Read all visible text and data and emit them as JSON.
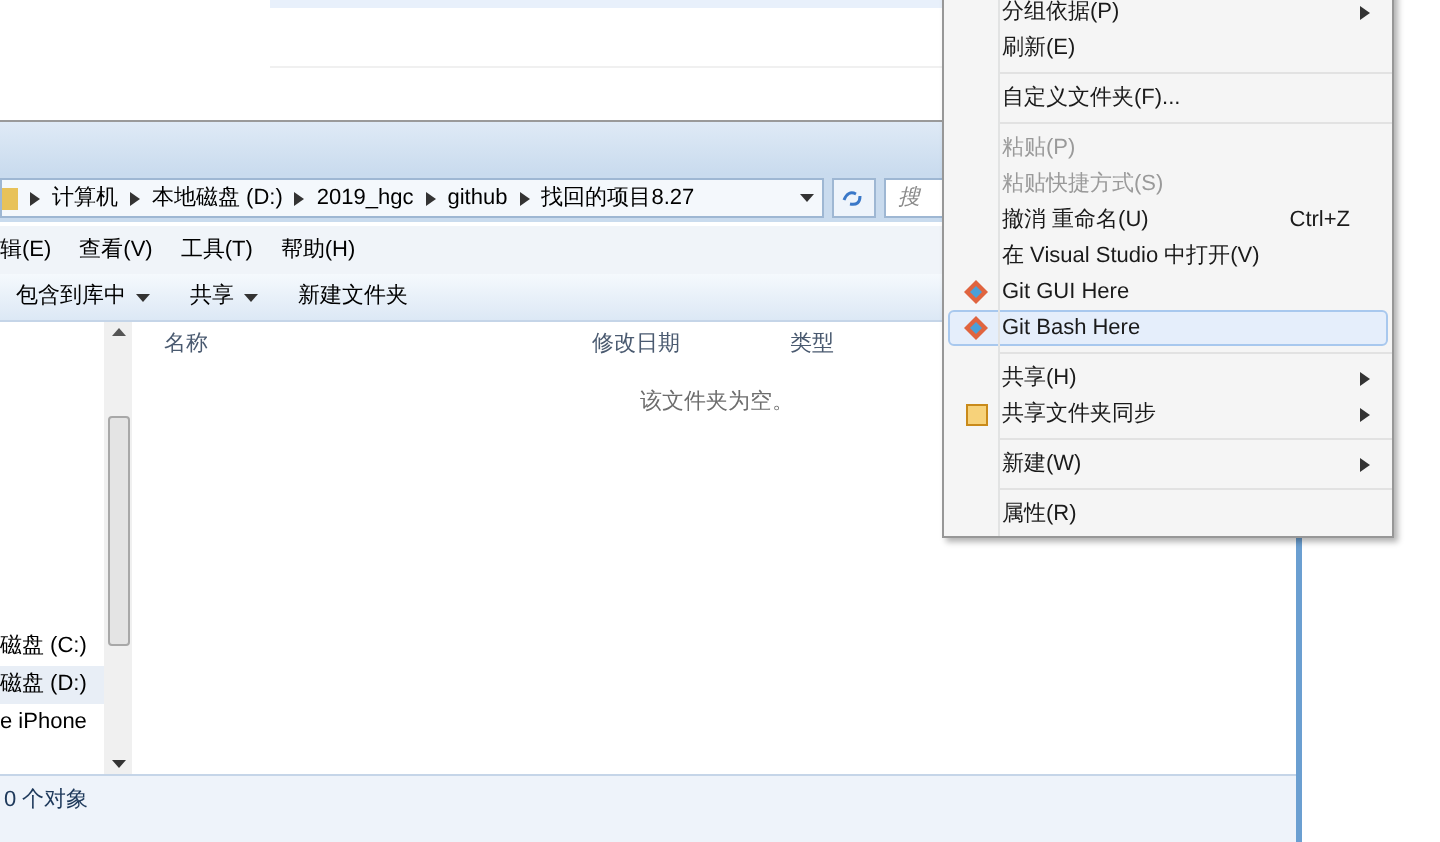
{
  "explorer": {
    "breadcrumb": [
      "计算机",
      "本地磁盘 (D:)",
      "2019_hgc",
      "github",
      "找回的项目8.27"
    ],
    "search": {
      "placeholder": "搜"
    },
    "menu_bar": [
      "辑(E)",
      "查看(V)",
      "工具(T)",
      "帮助(H)"
    ],
    "toolbar": [
      {
        "label": "包含到库中",
        "dropdown": true
      },
      {
        "label": "共享",
        "dropdown": true
      },
      {
        "label": "新建文件夹",
        "dropdown": false
      }
    ],
    "columns": [
      "名称",
      "修改日期",
      "类型"
    ],
    "empty_message": "该文件夹为空。",
    "sidebar": [
      {
        "label": "磁盘 (C:)",
        "selected": false
      },
      {
        "label": "磁盘 (D:)",
        "selected": true
      },
      {
        "label": "e iPhone",
        "selected": false
      }
    ],
    "status": "0 个对象"
  },
  "context_menu": [
    {
      "kind": "item",
      "label": "分组依据(P)",
      "submenu": true,
      "disabled": false,
      "selected": false
    },
    {
      "kind": "item",
      "label": "刷新(E)",
      "submenu": false,
      "disabled": false,
      "selected": false
    },
    {
      "kind": "separator"
    },
    {
      "kind": "item",
      "label": "自定义文件夹(F)...",
      "submenu": false,
      "disabled": false,
      "selected": false
    },
    {
      "kind": "separator"
    },
    {
      "kind": "item",
      "label": "粘贴(P)",
      "submenu": false,
      "disabled": true,
      "selected": false
    },
    {
      "kind": "item",
      "label": "粘贴快捷方式(S)",
      "submenu": false,
      "disabled": true,
      "selected": false
    },
    {
      "kind": "item",
      "label": "撤消 重命名(U)",
      "shortcut": "Ctrl+Z",
      "submenu": false,
      "disabled": false,
      "selected": false
    },
    {
      "kind": "item",
      "label": "在 Visual Studio 中打开(V)",
      "submenu": false,
      "disabled": false,
      "selected": false
    },
    {
      "kind": "git",
      "label": "Git GUI Here",
      "submenu": false,
      "disabled": false,
      "selected": false
    },
    {
      "kind": "git",
      "label": "Git Bash Here",
      "submenu": false,
      "disabled": false,
      "selected": true
    },
    {
      "kind": "separator"
    },
    {
      "kind": "item",
      "label": "共享(H)",
      "submenu": true,
      "disabled": false,
      "selected": false
    },
    {
      "kind": "sync",
      "label": "共享文件夹同步",
      "submenu": true,
      "disabled": false,
      "selected": false
    },
    {
      "kind": "separator"
    },
    {
      "kind": "item",
      "label": "新建(W)",
      "submenu": true,
      "disabled": false,
      "selected": false
    },
    {
      "kind": "separator"
    },
    {
      "kind": "item",
      "label": "属性(R)",
      "submenu": false,
      "disabled": false,
      "selected": false
    }
  ]
}
